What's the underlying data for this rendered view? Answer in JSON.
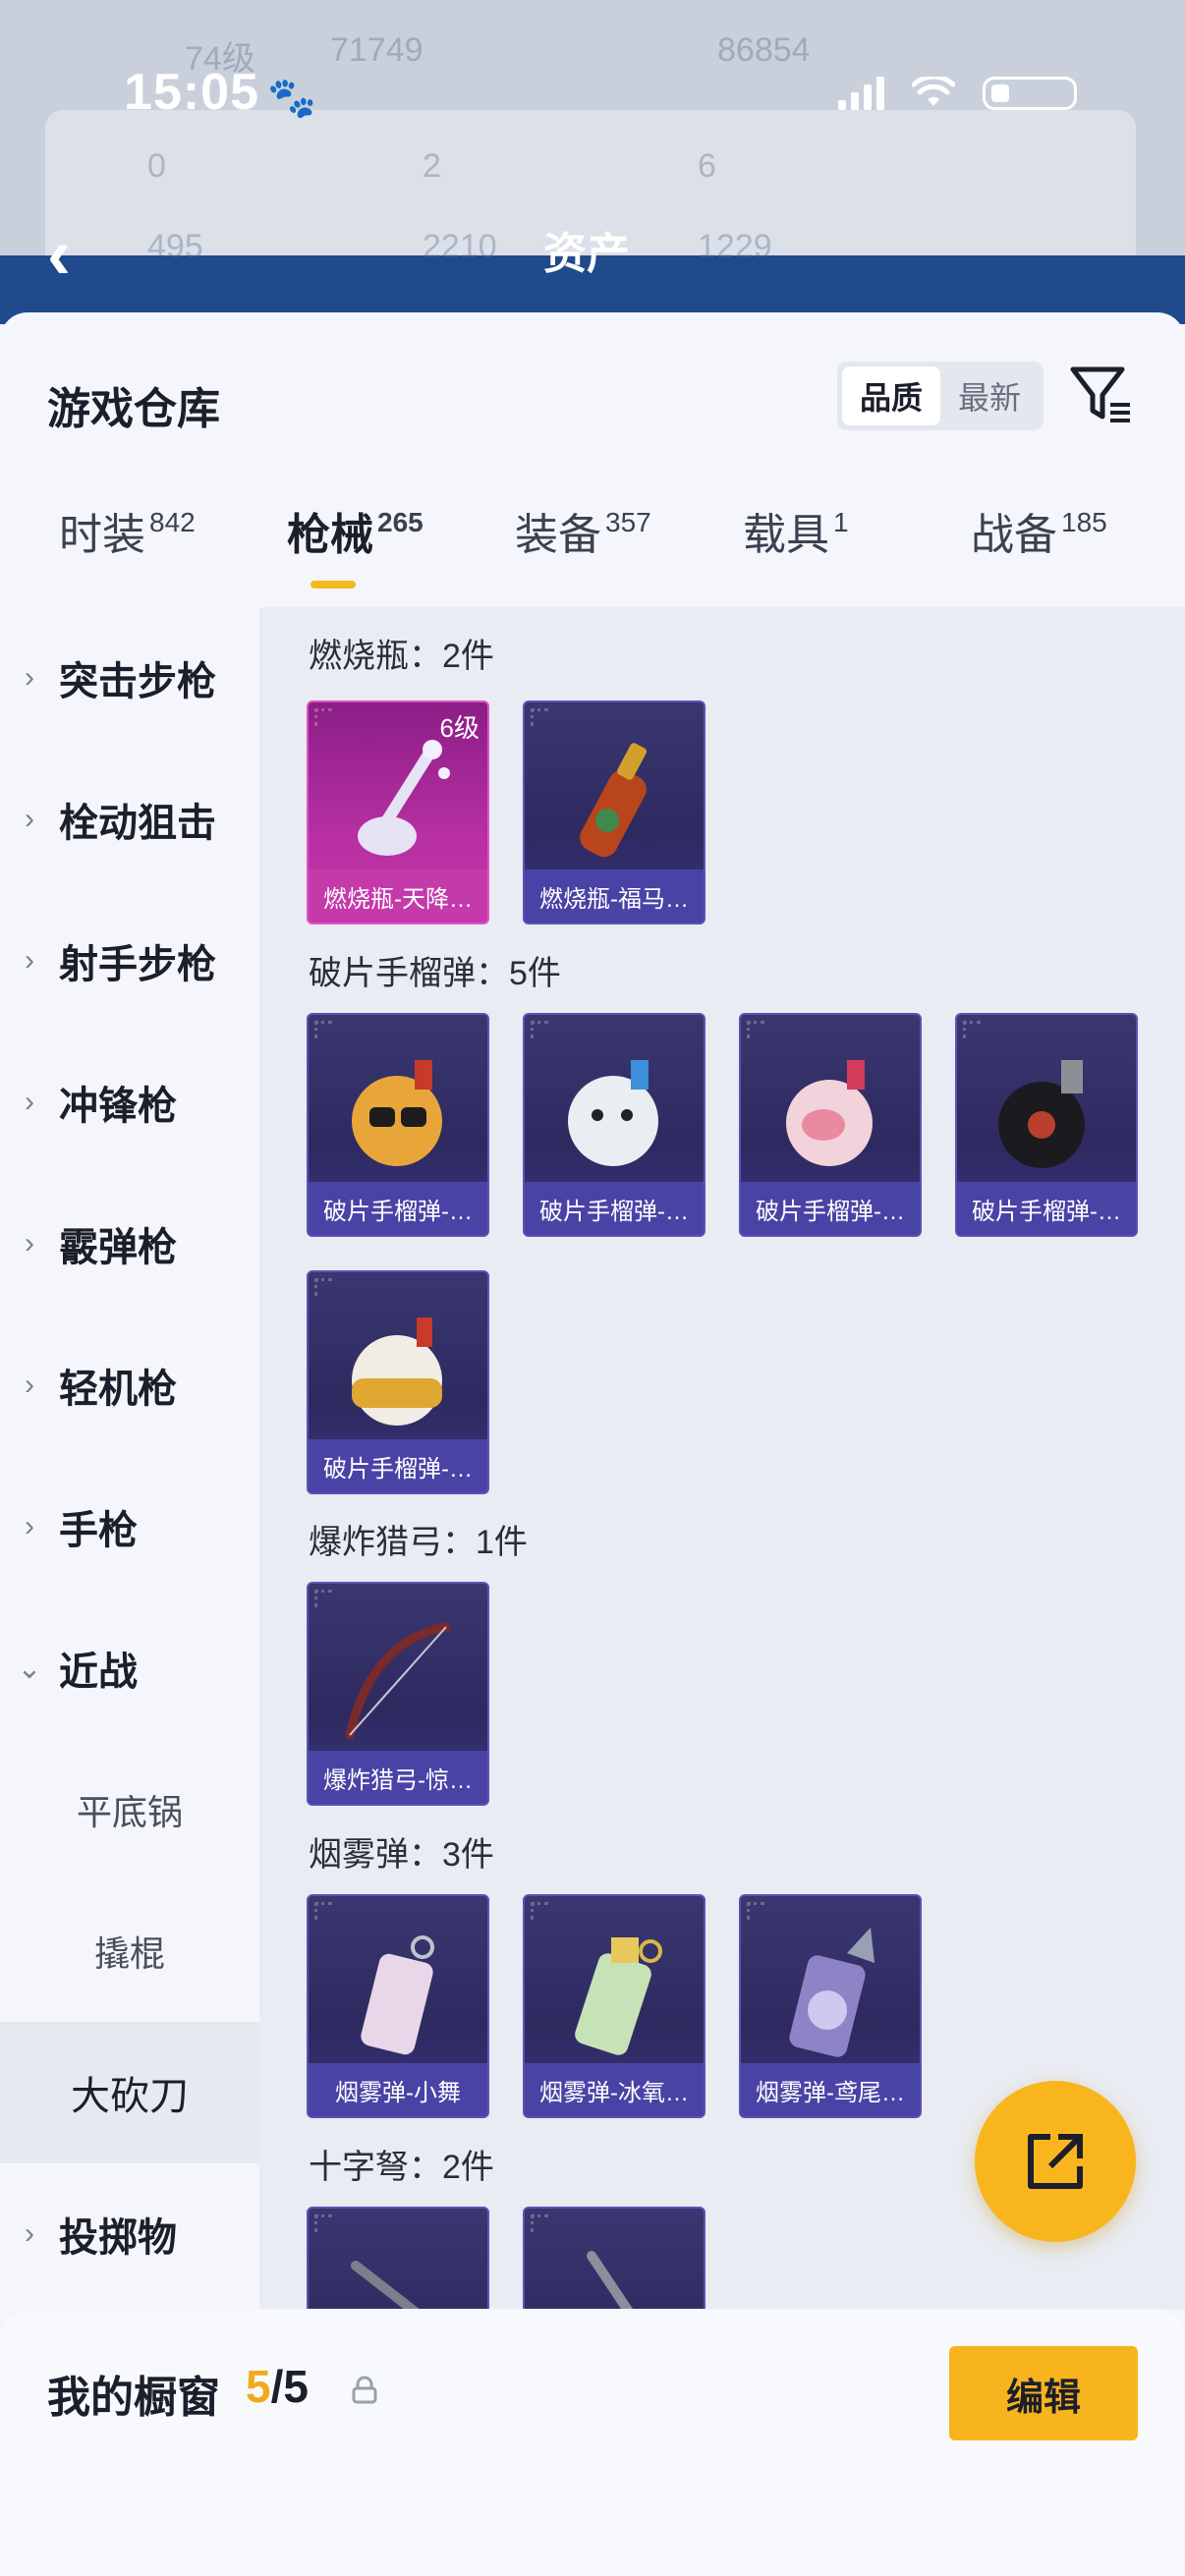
{
  "status_bar": {
    "time": "15:05"
  },
  "backdrop": {
    "title": "资产",
    "ghost_stats": [
      "74级",
      "71749",
      "86854",
      "0",
      "2",
      "6",
      "495",
      "2210",
      "1229"
    ]
  },
  "sheet": {
    "title": "游戏仓库",
    "sort": {
      "options": [
        "品质",
        "最新"
      ],
      "selected": "品质"
    }
  },
  "tabs": [
    {
      "label": "时装",
      "count": "842"
    },
    {
      "label": "枪械",
      "count": "265",
      "active": true
    },
    {
      "label": "装备",
      "count": "357"
    },
    {
      "label": "载具",
      "count": "1"
    },
    {
      "label": "战备",
      "count": "185"
    }
  ],
  "categories": [
    {
      "label": "突击步枪",
      "type": "collapsed"
    },
    {
      "label": "栓动狙击",
      "type": "collapsed"
    },
    {
      "label": "射手步枪",
      "type": "collapsed"
    },
    {
      "label": "冲锋枪",
      "type": "collapsed"
    },
    {
      "label": "霰弹枪",
      "type": "collapsed"
    },
    {
      "label": "轻机枪",
      "type": "collapsed"
    },
    {
      "label": "手枪",
      "type": "collapsed"
    },
    {
      "label": "近战",
      "type": "expanded"
    },
    {
      "label": "平底锅",
      "type": "sub"
    },
    {
      "label": "撬棍",
      "type": "sub"
    },
    {
      "label": "大砍刀",
      "type": "selected"
    },
    {
      "label": "投掷物",
      "type": "collapsed"
    }
  ],
  "sections": [
    {
      "title": "燃烧瓶：2件",
      "items": [
        {
          "name": "燃烧瓶-天降…",
          "rarity": "pink",
          "level": "6级"
        },
        {
          "name": "燃烧瓶-福马…",
          "rarity": "purple"
        }
      ]
    },
    {
      "title": "破片手榴弹：5件",
      "items": [
        {
          "name": "破片手榴弹-…",
          "rarity": "purple"
        },
        {
          "name": "破片手榴弹-…",
          "rarity": "purple"
        },
        {
          "name": "破片手榴弹-…",
          "rarity": "purple"
        },
        {
          "name": "破片手榴弹-…",
          "rarity": "purple"
        },
        {
          "name": "破片手榴弹-…",
          "rarity": "purple"
        }
      ]
    },
    {
      "title": "爆炸猎弓：1件",
      "items": [
        {
          "name": "爆炸猎弓-惊…",
          "rarity": "purple"
        }
      ]
    },
    {
      "title": "烟雾弹：3件",
      "items": [
        {
          "name": "烟雾弹-小舞",
          "rarity": "purple"
        },
        {
          "name": "烟雾弹-冰氧…",
          "rarity": "purple"
        },
        {
          "name": "烟雾弹-鸢尾…",
          "rarity": "purple"
        }
      ]
    },
    {
      "title": "十字弩：2件",
      "items": [
        {
          "name": "",
          "rarity": "purple"
        },
        {
          "name": "",
          "rarity": "purple"
        }
      ]
    }
  ],
  "showcase": {
    "title": "我的橱窗",
    "current": "5",
    "separator": "/",
    "total": "5",
    "edit_label": "编辑"
  },
  "colors": {
    "accent": "#f7b41d",
    "purple_card": "#4a43a6",
    "pink_card": "#c43aab"
  }
}
